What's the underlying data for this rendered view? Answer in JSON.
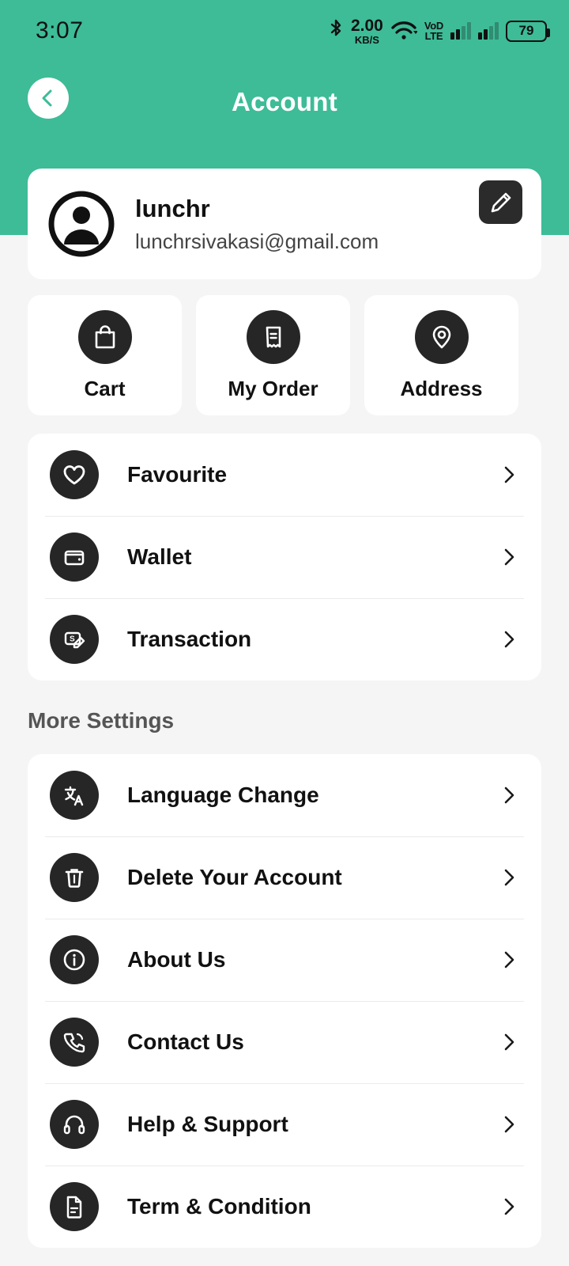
{
  "status_bar": {
    "time": "3:07",
    "bluetooth_icon": "bluetooth-icon",
    "data_speed_value": "2.00",
    "data_speed_unit": "KB/S",
    "wifi_icon": "wifi-icon",
    "network_type_top": "VoD",
    "network_type_bottom": "LTE",
    "signal_icon_1": "signal-bars-icon",
    "signal_icon_2": "signal-bars-icon",
    "battery_level": "79"
  },
  "header": {
    "title": "Account",
    "back_icon": "chevron-left-icon",
    "background_color": "#3DBC97"
  },
  "profile": {
    "avatar_icon": "user-avatar-icon",
    "name": "lunchr",
    "email": "lunchrsivakasi@gmail.com",
    "edit_icon": "pencil-edit-icon"
  },
  "quick_actions": [
    {
      "label": "Cart",
      "icon": "shopping-bag-icon"
    },
    {
      "label": "My Order",
      "icon": "receipt-icon"
    },
    {
      "label": "Address",
      "icon": "location-pin-icon"
    }
  ],
  "account_menu": [
    {
      "label": "Favourite",
      "icon": "heart-icon",
      "chevron": "chevron-right-icon"
    },
    {
      "label": "Wallet",
      "icon": "wallet-icon",
      "chevron": "chevron-right-icon"
    },
    {
      "label": "Transaction",
      "icon": "transaction-icon",
      "chevron": "chevron-right-icon"
    }
  ],
  "more_settings": {
    "section_title": "More Settings",
    "items": [
      {
        "label": "Language Change",
        "icon": "translate-icon",
        "chevron": "chevron-right-icon"
      },
      {
        "label": "Delete Your Account",
        "icon": "trash-icon",
        "chevron": "chevron-right-icon"
      },
      {
        "label": "About Us",
        "icon": "info-icon",
        "chevron": "chevron-right-icon"
      },
      {
        "label": "Contact Us",
        "icon": "phone-icon",
        "chevron": "chevron-right-icon"
      },
      {
        "label": "Help & Support",
        "icon": "headset-icon",
        "chevron": "chevron-right-icon"
      },
      {
        "label": "Term & Condition",
        "icon": "document-icon",
        "chevron": "chevron-right-icon"
      }
    ]
  },
  "theme": {
    "accent": "#3DBC97",
    "icon_bg": "#262626",
    "page_bg": "#F5F5F5",
    "card_bg": "#FFFFFF"
  }
}
